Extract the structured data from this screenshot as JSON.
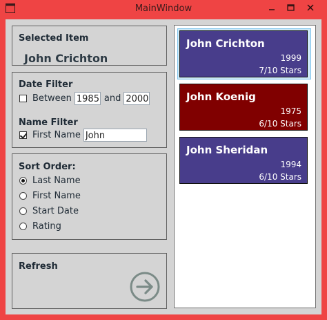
{
  "window": {
    "title": "MainWindow"
  },
  "selected_item": {
    "heading": "Selected Item",
    "name": "John Crichton"
  },
  "date_filter": {
    "heading": "Date Filter",
    "checked": false,
    "label": "Between",
    "from": "1985",
    "and_label": "and",
    "to": "2000"
  },
  "name_filter": {
    "heading": "Name Filter",
    "checked": true,
    "label": "First Name",
    "value": "John"
  },
  "sort_order": {
    "heading": "Sort Order:",
    "options": [
      "Last Name",
      "First Name",
      "Start Date",
      "Rating"
    ],
    "selected": "Last Name"
  },
  "refresh": {
    "label": "Refresh",
    "icon": "arrow-right-circle-icon"
  },
  "people": [
    {
      "name": "John Crichton",
      "year": "1999",
      "rating": "7/10 Stars",
      "color": "#483d8b",
      "selected": true
    },
    {
      "name": "John Koenig",
      "year": "1975",
      "rating": "6/10 Stars",
      "color": "#800000",
      "selected": false
    },
    {
      "name": "John Sheridan",
      "year": "1994",
      "rating": "6/10 Stars",
      "color": "#483d8b",
      "selected": false
    }
  ],
  "colors": {
    "window_border": "#ef4444",
    "client_bg": "#d4d4d4"
  }
}
